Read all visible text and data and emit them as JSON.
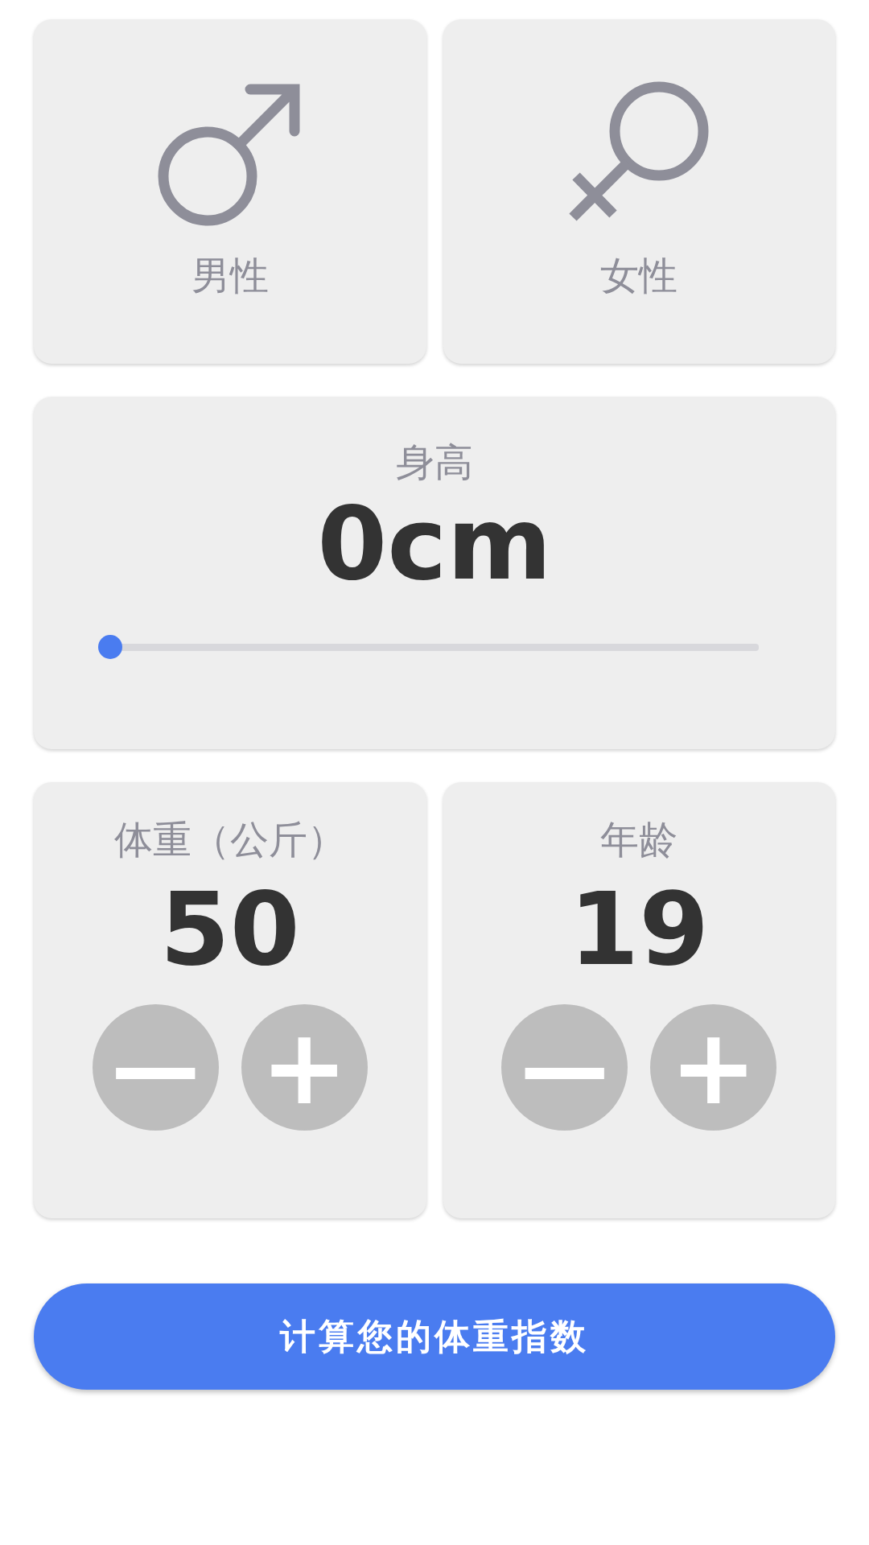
{
  "genders": [
    {
      "kind": "male",
      "label": "男性",
      "selected": false
    },
    {
      "kind": "female",
      "label": "女性",
      "selected": false
    }
  ],
  "height": {
    "label": "身高",
    "value": "0cm",
    "level": 0
  },
  "counters": [
    {
      "label": "体重（公斤）",
      "value": "50",
      "minus": "—",
      "plus": "+"
    },
    {
      "label": "年龄",
      "value": "19",
      "minus": "—",
      "plus": "+"
    }
  ],
  "submit": "计算您的体重指数"
}
